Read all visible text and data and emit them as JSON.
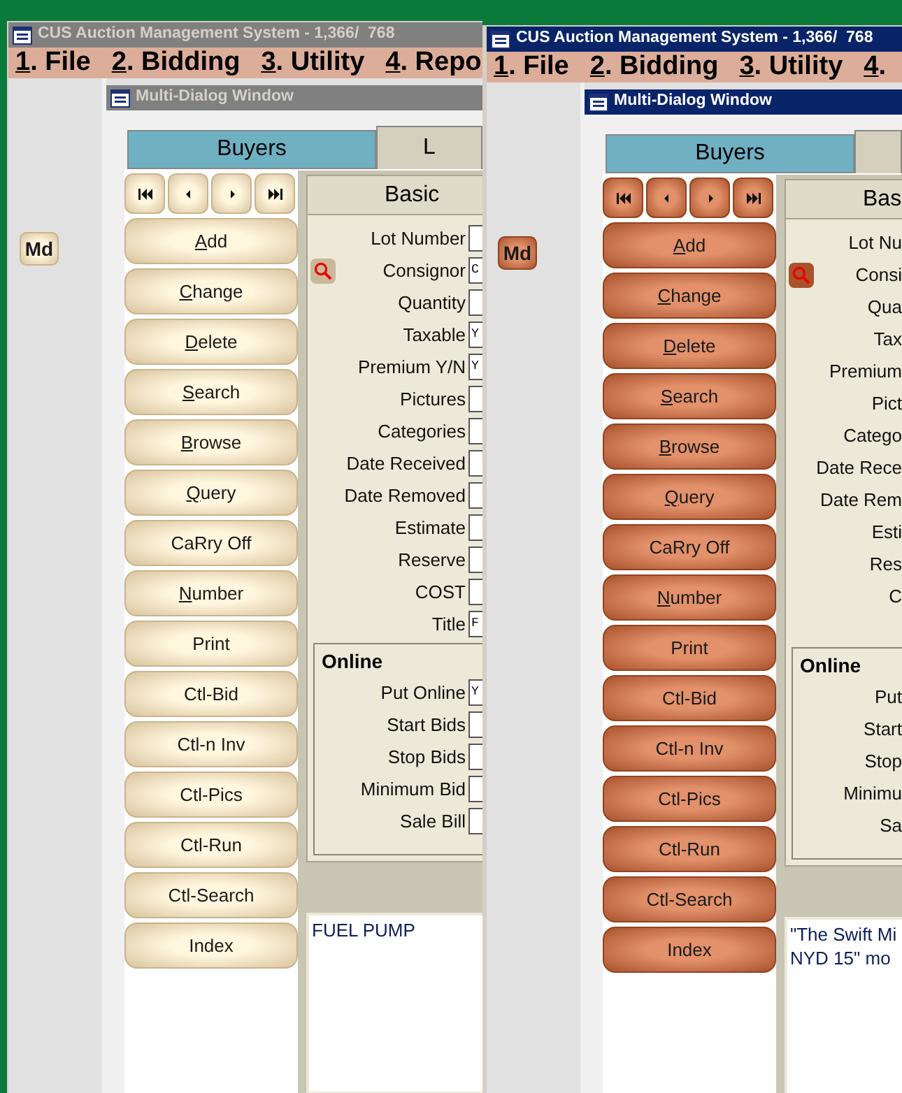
{
  "windows": [
    {
      "title": "CUS Auction Management System - 1,366/  768",
      "active": false,
      "menu": [
        {
          "label": "1. File",
          "mnemonic": true
        },
        {
          "label": "2. Bidding",
          "mnemonic": true
        },
        {
          "label": "3. Utility",
          "mnemonic": true
        },
        {
          "label": "4. Repo",
          "mnemonic": true
        }
      ],
      "side_button": "Md",
      "dialog": {
        "title": "Multi-Dialog Window",
        "tabs": [
          {
            "label": "Buyers",
            "selected": false
          },
          {
            "label": "L",
            "selected": true
          }
        ],
        "buttons": [
          {
            "label": "Add",
            "mnemonic": true
          },
          {
            "label": "Change",
            "mnemonic": true
          },
          {
            "label": "Delete",
            "mnemonic": true
          },
          {
            "label": "Search",
            "mnemonic": true
          },
          {
            "label": "Browse",
            "mnemonic": true
          },
          {
            "label": "Query",
            "mnemonic": true
          },
          {
            "label": "CaRry Off",
            "mnemonic": false
          },
          {
            "label": "Number",
            "mnemonic": true
          },
          {
            "label": "Print",
            "mnemonic": false
          },
          {
            "label": "Ctl-Bid",
            "mnemonic": false
          },
          {
            "label": "Ctl-n Inv",
            "mnemonic": false
          },
          {
            "label": "Ctl-Pics",
            "mnemonic": false
          },
          {
            "label": "Ctl-Run",
            "mnemonic": false
          },
          {
            "label": "Ctl-Search",
            "mnemonic": false
          },
          {
            "label": "Index",
            "mnemonic": false
          }
        ],
        "group": {
          "title": "Basic",
          "fields": [
            {
              "kind": "input",
              "label": "Lot Number"
            },
            {
              "kind": "input",
              "label": "Consignor",
              "value": "C",
              "lookup": true
            },
            {
              "kind": "input",
              "label": "Quantity"
            },
            {
              "kind": "input",
              "label": "Taxable",
              "value": "Y"
            },
            {
              "kind": "input",
              "label": "Premium Y/N",
              "value": "Y"
            },
            {
              "kind": "input",
              "label": "Pictures"
            },
            {
              "kind": "input",
              "label": "Categories"
            },
            {
              "kind": "input",
              "label": "Date Received"
            },
            {
              "kind": "input",
              "label": "Date Removed"
            },
            {
              "kind": "input",
              "label": "Estimate"
            },
            {
              "kind": "input",
              "label": "Reserve"
            },
            {
              "kind": "input",
              "label": "COST"
            },
            {
              "kind": "input",
              "label": "Title",
              "value": "F"
            }
          ]
        },
        "online": {
          "title": "Online",
          "fields": [
            {
              "kind": "input",
              "label": "Put Online",
              "value": "Y"
            },
            {
              "kind": "input",
              "label": "Start Bids"
            },
            {
              "kind": "input",
              "label": "Stop Bids"
            },
            {
              "kind": "input",
              "label": "Minimum Bid"
            },
            {
              "kind": "input",
              "label": "Sale Bill"
            }
          ]
        },
        "notes": [
          "FUEL PUMP"
        ]
      }
    },
    {
      "title": "CUS Auction Management System - 1,366/  768",
      "active": true,
      "menu": [
        {
          "label": "1. File",
          "mnemonic": true
        },
        {
          "label": "2. Bidding",
          "mnemonic": true
        },
        {
          "label": "3. Utility",
          "mnemonic": true
        },
        {
          "label": "4.",
          "mnemonic": true
        }
      ],
      "side_button": "Md",
      "dialog": {
        "title": "Multi-Dialog Window",
        "tabs": [
          {
            "label": "Buyers",
            "selected": false
          },
          {
            "selected": true
          }
        ],
        "buttons": [
          {
            "label": "Add",
            "mnemonic": true
          },
          {
            "label": "Change",
            "mnemonic": true
          },
          {
            "label": "Delete",
            "mnemonic": true
          },
          {
            "label": "Search",
            "mnemonic": true
          },
          {
            "label": "Browse",
            "mnemonic": true
          },
          {
            "label": "Query",
            "mnemonic": true
          },
          {
            "label": "CaRry Off",
            "mnemonic": false
          },
          {
            "label": "Number",
            "mnemonic": true
          },
          {
            "label": "Print",
            "mnemonic": false
          },
          {
            "label": "Ctl-Bid",
            "mnemonic": false
          },
          {
            "label": "Ctl-n Inv",
            "mnemonic": false
          },
          {
            "label": "Ctl-Pics",
            "mnemonic": false
          },
          {
            "label": "Ctl-Run",
            "mnemonic": false
          },
          {
            "label": "Ctl-Search",
            "mnemonic": false
          },
          {
            "label": "Index",
            "mnemonic": false
          }
        ],
        "group": {
          "title": "Bas",
          "fields": [
            {
              "kind": "label",
              "label": "Lot Nu"
            },
            {
              "kind": "label",
              "label": "Consi",
              "lookup": true
            },
            {
              "kind": "label",
              "label": "Qua"
            },
            {
              "kind": "label",
              "label": "Tax"
            },
            {
              "kind": "label",
              "label": "Premium"
            },
            {
              "kind": "label",
              "label": "Pict"
            },
            {
              "kind": "label",
              "label": "Catego"
            },
            {
              "kind": "label",
              "label": "Date Rece"
            },
            {
              "kind": "label",
              "label": "Date Rem"
            },
            {
              "kind": "label",
              "label": "Esti"
            },
            {
              "kind": "label",
              "label": "Res"
            },
            {
              "kind": "label",
              "label": "C"
            },
            {
              "kind": "blank"
            }
          ]
        },
        "online": {
          "title": "Online",
          "fields": [
            {
              "kind": "label",
              "label": "Put"
            },
            {
              "kind": "label",
              "label": "Start"
            },
            {
              "kind": "label",
              "label": "Stop"
            },
            {
              "kind": "label",
              "label": "Minimu"
            },
            {
              "kind": "label",
              "label": "Sa"
            }
          ]
        },
        "notes": [
          "\"The Swift Mi",
          "NYD 15\" mo"
        ]
      }
    }
  ]
}
